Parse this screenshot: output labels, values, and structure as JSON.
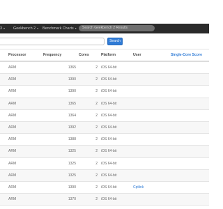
{
  "nav": {
    "items": [
      {
        "label": "3",
        "has_caret": true
      },
      {
        "label": "Geekbench 2",
        "has_caret": true
      },
      {
        "label": "Benchmark Charts",
        "has_caret": true
      }
    ],
    "search_placeholder": "Search Geekbench 2 Results"
  },
  "search": {
    "value": "",
    "button_label": "Search"
  },
  "table": {
    "headers": {
      "processor": "Processor",
      "frequency": "Frequency",
      "cores": "Cores",
      "platform": "Platform",
      "user": "User",
      "single_core": "Single-Core Score"
    },
    "rows": [
      {
        "processor": "ARM",
        "frequency": "1365",
        "cores": "2",
        "platform": "iOS 64-bit",
        "user": ""
      },
      {
        "processor": "ARM",
        "frequency": "1390",
        "cores": "2",
        "platform": "iOS 64-bit",
        "user": ""
      },
      {
        "processor": "ARM",
        "frequency": "1390",
        "cores": "2",
        "platform": "iOS 64-bit",
        "user": ""
      },
      {
        "processor": "ARM",
        "frequency": "1365",
        "cores": "2",
        "platform": "iOS 64-bit",
        "user": ""
      },
      {
        "processor": "ARM",
        "frequency": "1364",
        "cores": "2",
        "platform": "iOS 64-bit",
        "user": ""
      },
      {
        "processor": "ARM",
        "frequency": "1392",
        "cores": "2",
        "platform": "iOS 64-bit",
        "user": ""
      },
      {
        "processor": "ARM",
        "frequency": "1388",
        "cores": "2",
        "platform": "iOS 64-bit",
        "user": ""
      },
      {
        "processor": "ARM",
        "frequency": "1325",
        "cores": "2",
        "platform": "iOS 64-bit",
        "user": ""
      },
      {
        "processor": "ARM",
        "frequency": "1325",
        "cores": "2",
        "platform": "iOS 64-bit",
        "user": ""
      },
      {
        "processor": "ARM",
        "frequency": "1325",
        "cores": "2",
        "platform": "iOS 64-bit",
        "user": ""
      },
      {
        "processor": "ARM",
        "frequency": "1390",
        "cores": "2",
        "platform": "iOS 64-bit",
        "user": "Cptlink"
      },
      {
        "processor": "ARM",
        "frequency": "1370",
        "cores": "2",
        "platform": "iOS 64-bit",
        "user": ""
      }
    ]
  },
  "colors": {
    "nav_bg": "#2b2b2b",
    "link": "#2f7bd6",
    "button": "#2f7bd6"
  }
}
